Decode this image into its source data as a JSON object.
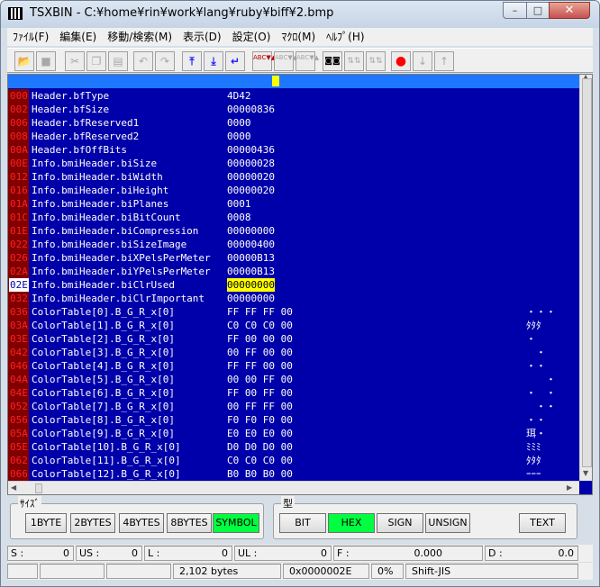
{
  "window": {
    "title": "TSXBIN - C:¥home¥rin¥work¥lang¥ruby¥biff¥2.bmp",
    "min": "–",
    "max": "□",
    "close": "✕"
  },
  "menu": [
    "ﾌｧｲﾙ(F)",
    "編集(E)",
    "移動/検索(M)",
    "表示(D)",
    "設定(O)",
    "ﾏｸﾛ(M)",
    "ﾍﾙﾌﾟ(H)"
  ],
  "toolbar": {
    "open": "📂",
    "save": "■",
    "cut": "✂",
    "copy": "❐",
    "paste": "▤",
    "undo": "↶",
    "redo": "↷",
    "top": "⤒",
    "bottom": "⤓",
    "jump": "↵",
    "abc1": "ABC▼▲",
    "abc2": "ABC▼▲",
    "abc3": "ABC▼▲",
    "find": "◙◙",
    "findnext": "⇅⇅",
    "findprev": "⇅⇅",
    "mark": "●",
    "down": "↓",
    "up": "↑"
  },
  "rows": [
    {
      "addr": "000",
      "name": "Header.bfType",
      "val": "4D42",
      "sym": ""
    },
    {
      "addr": "002",
      "name": "Header.bfSize",
      "val": "00000836",
      "sym": ""
    },
    {
      "addr": "006",
      "name": "Header.bfReserved1",
      "val": "0000",
      "sym": ""
    },
    {
      "addr": "008",
      "name": "Header.bfReserved2",
      "val": "0000",
      "sym": ""
    },
    {
      "addr": "00A",
      "name": "Header.bfOffBits",
      "val": "00000436",
      "sym": ""
    },
    {
      "addr": "00E",
      "name": "Info.bmiHeader.biSize",
      "val": "00000028",
      "sym": ""
    },
    {
      "addr": "012",
      "name": "Info.bmiHeader.biWidth",
      "val": "00000020",
      "sym": ""
    },
    {
      "addr": "016",
      "name": "Info.bmiHeader.biHeight",
      "val": "00000020",
      "sym": ""
    },
    {
      "addr": "01A",
      "name": "Info.bmiHeader.biPlanes",
      "val": "0001",
      "sym": ""
    },
    {
      "addr": "01C",
      "name": "Info.bmiHeader.biBitCount",
      "val": "0008",
      "sym": ""
    },
    {
      "addr": "01E",
      "name": "Info.bmiHeader.biCompression",
      "val": "00000000",
      "sym": ""
    },
    {
      "addr": "022",
      "name": "Info.bmiHeader.biSizeImage",
      "val": "00000400",
      "sym": ""
    },
    {
      "addr": "026",
      "name": "Info.bmiHeader.biXPelsPerMeter",
      "val": "00000B13",
      "sym": ""
    },
    {
      "addr": "02A",
      "name": "Info.bmiHeader.biYPelsPerMeter",
      "val": "00000B13",
      "sym": ""
    },
    {
      "addr": "02E",
      "name": "Info.bmiHeader.biClrUsed",
      "val": "00000000",
      "sym": "",
      "selected": true
    },
    {
      "addr": "032",
      "name": "Info.bmiHeader.biClrImportant",
      "val": "00000000",
      "sym": ""
    },
    {
      "addr": "036",
      "name": "ColorTable[0].B_G_R_x[0]",
      "val": "FF FF FF 00",
      "sym": "・・・"
    },
    {
      "addr": "03A",
      "name": "ColorTable[1].B_G_R_x[0]",
      "val": "C0 C0 C0 00",
      "sym": "ﾀﾀﾀ"
    },
    {
      "addr": "03E",
      "name": "ColorTable[2].B_G_R_x[0]",
      "val": "FF 00 00 00",
      "sym": "・"
    },
    {
      "addr": "042",
      "name": "ColorTable[3].B_G_R_x[0]",
      "val": "00 FF 00 00",
      "sym": "　・"
    },
    {
      "addr": "046",
      "name": "ColorTable[4].B_G_R_x[0]",
      "val": "FF FF 00 00",
      "sym": "・・"
    },
    {
      "addr": "04A",
      "name": "ColorTable[5].B_G_R_x[0]",
      "val": "00 00 FF 00",
      "sym": "　　・"
    },
    {
      "addr": "04E",
      "name": "ColorTable[6].B_G_R_x[0]",
      "val": "FF 00 FF 00",
      "sym": "・　・"
    },
    {
      "addr": "052",
      "name": "ColorTable[7].B_G_R_x[0]",
      "val": "00 FF FF 00",
      "sym": "　・・"
    },
    {
      "addr": "056",
      "name": "ColorTable[8].B_G_R_x[0]",
      "val": "F0 F0 F0 00",
      "sym": "・・"
    },
    {
      "addr": "05A",
      "name": "ColorTable[9].B_G_R_x[0]",
      "val": "E0 E0 E0 00",
      "sym": "珥・"
    },
    {
      "addr": "05E",
      "name": "ColorTable[10].B_G_R_x[0]",
      "val": "D0 D0 D0 00",
      "sym": "ﾐﾐﾐ"
    },
    {
      "addr": "062",
      "name": "ColorTable[11].B_G_R_x[0]",
      "val": "C0 C0 C0 00",
      "sym": "ﾀﾀﾀ"
    },
    {
      "addr": "066",
      "name": "ColorTable[12].B_G_R_x[0]",
      "val": "B0 B0 B0 00",
      "sym": "ｰｰｰ"
    }
  ],
  "size_group": {
    "label": "ｻｲｽﾞ",
    "buttons": [
      {
        "label": "1BYTE",
        "active": false
      },
      {
        "label": "2BYTES",
        "active": false
      },
      {
        "label": "4BYTES",
        "active": false
      },
      {
        "label": "8BYTES",
        "active": false
      },
      {
        "label": "SYMBOL",
        "active": true
      }
    ]
  },
  "type_group": {
    "label": "型",
    "buttons": [
      {
        "label": "BIT",
        "active": false
      },
      {
        "label": "HEX",
        "active": true
      },
      {
        "label": "SIGN",
        "active": false
      },
      {
        "label": "UNSIGN",
        "active": false
      },
      {
        "label": "TEXT",
        "active": false
      }
    ]
  },
  "status1": [
    {
      "label": "S :",
      "value": "0"
    },
    {
      "label": "US :",
      "value": "0"
    },
    {
      "label": "L :",
      "value": "0"
    },
    {
      "label": "UL :",
      "value": "0"
    },
    {
      "label": "F :",
      "value": "0.000"
    },
    {
      "label": "D :",
      "value": "0.0"
    }
  ],
  "status2": {
    "size": "2,102 bytes",
    "offset": "0x0000002E",
    "percent": "0%",
    "encoding": "Shift-JIS"
  }
}
